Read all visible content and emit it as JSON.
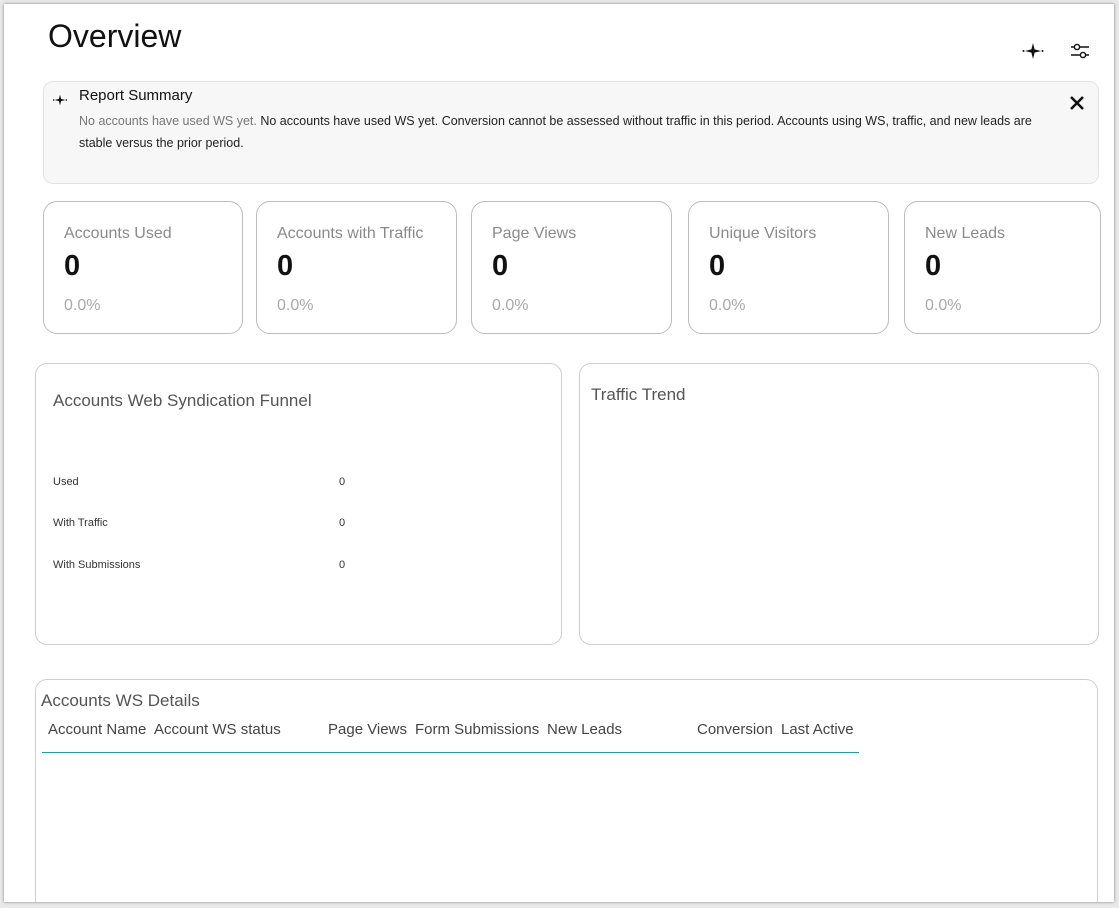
{
  "header": {
    "title": "Overview",
    "icons": [
      "sparkle-icon",
      "sliders-icon"
    ]
  },
  "summary": {
    "title": "Report Summary",
    "muted_text": "No accounts have used WS yet.",
    "text": " No accounts have used WS yet. Conversion cannot be assessed without traffic in this period. Accounts using WS, traffic, and new leads are stable versus the prior period."
  },
  "kpis": [
    {
      "label": "Accounts Used",
      "value": "0",
      "delta": "0.0%"
    },
    {
      "label": "Accounts with Traffic",
      "value": "0",
      "delta": "0.0%"
    },
    {
      "label": "Page Views",
      "value": "0",
      "delta": "0.0%"
    },
    {
      "label": "Unique Visitors",
      "value": "0",
      "delta": "0.0%"
    },
    {
      "label": "New Leads",
      "value": "0",
      "delta": "0.0%"
    }
  ],
  "funnel": {
    "title": "Accounts Web Syndication Funnel",
    "rows": [
      {
        "label": "Used",
        "value": "0"
      },
      {
        "label": "With Traffic",
        "value": "0"
      },
      {
        "label": "With Submissions",
        "value": "0"
      }
    ]
  },
  "trend": {
    "title": "Traffic Trend"
  },
  "details": {
    "title": "Accounts WS Details",
    "columns": [
      "Account Name",
      "Account WS status",
      "Page Views",
      "Form Submissions",
      "New Leads",
      "Conversion",
      "Last Active"
    ]
  },
  "colors": {
    "accent_line": "#2a9d9a",
    "muted_text": "#8a8a8a"
  }
}
